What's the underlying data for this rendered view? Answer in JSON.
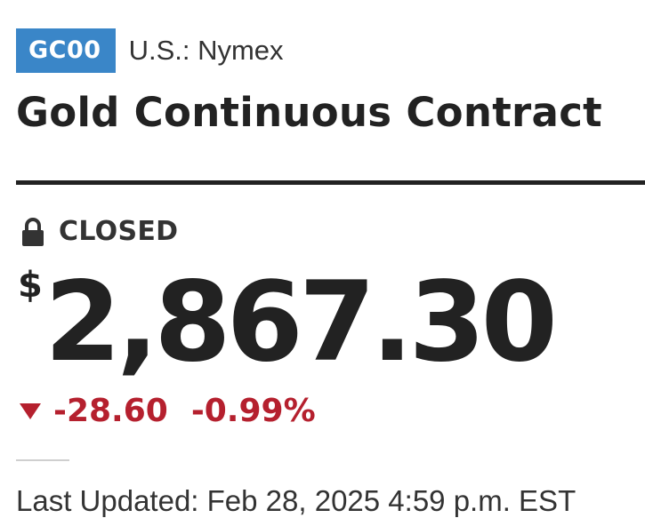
{
  "quote": {
    "symbol": "GC00",
    "exchange": "U.S.: Nymex",
    "name": "Gold Continuous Contract",
    "status": "CLOSED",
    "currency_symbol": "$",
    "price": "2,867.30",
    "change": "-28.60",
    "change_percent": "-0.99%",
    "last_updated": "Last Updated: Feb 28, 2025 4:59 p.m. EST"
  },
  "colors": {
    "badge": "#3a86c8",
    "negative": "#b5202e",
    "text": "#222222"
  },
  "icons": {
    "status": "lock-icon",
    "direction": "down-triangle-icon"
  }
}
